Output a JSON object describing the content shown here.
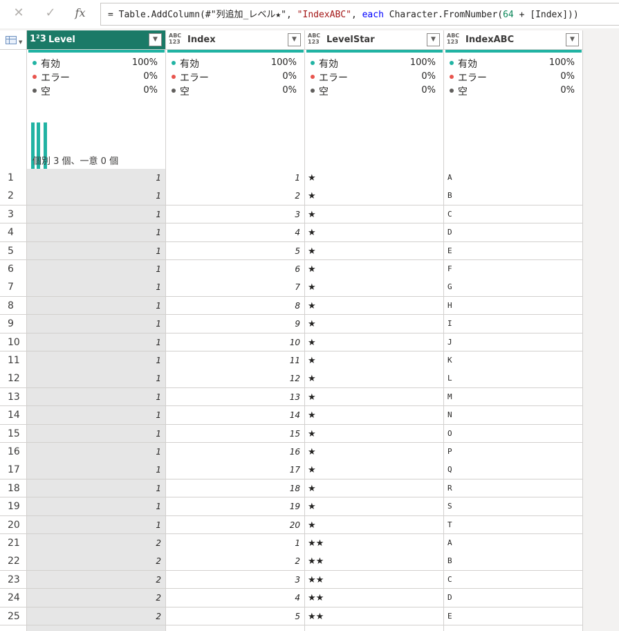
{
  "formula_bar": {
    "cancel_icon": "close-icon",
    "confirm_icon": "checkmark-icon",
    "fx_label": "fx",
    "formula_parts": {
      "p1": "= Table.AddColumn(#\"列追加_レベル★\", ",
      "p2": "\"IndexABC\"",
      "p3": ", ",
      "p4": "each",
      "p5": " Character.FromNumber(",
      "p6": "64",
      "p7": " + [Index]))"
    }
  },
  "columns": [
    {
      "type_label": "1²3",
      "title": "Level",
      "selected": true
    },
    {
      "type_label": "ABC 123",
      "title": "Index",
      "selected": false
    },
    {
      "type_label": "ABC 123",
      "title": "LevelStar",
      "selected": false
    },
    {
      "type_label": "ABC 123",
      "title": "IndexABC",
      "selected": false
    }
  ],
  "profile": {
    "valid_label": "有効",
    "error_label": "エラー",
    "empty_label": "空",
    "valid_pct": "100%",
    "error_pct": "0%",
    "empty_pct": "0%",
    "distribution_label": "個別 3 個、一意 0 個",
    "colors": {
      "valid": "#21b3a3",
      "error": "#e8554e",
      "empty": "#605e5c",
      "accent": "#1b7a67"
    }
  },
  "rows": [
    {
      "n": "1",
      "level": "1",
      "index": "1",
      "star": "★",
      "abc": "A"
    },
    {
      "n": "2",
      "level": "1",
      "index": "2",
      "star": "★",
      "abc": "B"
    },
    {
      "n": "3",
      "level": "1",
      "index": "3",
      "star": "★",
      "abc": "C"
    },
    {
      "n": "4",
      "level": "1",
      "index": "4",
      "star": "★",
      "abc": "D"
    },
    {
      "n": "5",
      "level": "1",
      "index": "5",
      "star": "★",
      "abc": "E"
    },
    {
      "n": "6",
      "level": "1",
      "index": "6",
      "star": "★",
      "abc": "F"
    },
    {
      "n": "7",
      "level": "1",
      "index": "7",
      "star": "★",
      "abc": "G"
    },
    {
      "n": "8",
      "level": "1",
      "index": "8",
      "star": "★",
      "abc": "H"
    },
    {
      "n": "9",
      "level": "1",
      "index": "9",
      "star": "★",
      "abc": "I"
    },
    {
      "n": "10",
      "level": "1",
      "index": "10",
      "star": "★",
      "abc": "J"
    },
    {
      "n": "11",
      "level": "1",
      "index": "11",
      "star": "★",
      "abc": "K"
    },
    {
      "n": "12",
      "level": "1",
      "index": "12",
      "star": "★",
      "abc": "L"
    },
    {
      "n": "13",
      "level": "1",
      "index": "13",
      "star": "★",
      "abc": "M"
    },
    {
      "n": "14",
      "level": "1",
      "index": "14",
      "star": "★",
      "abc": "N"
    },
    {
      "n": "15",
      "level": "1",
      "index": "15",
      "star": "★",
      "abc": "O"
    },
    {
      "n": "16",
      "level": "1",
      "index": "16",
      "star": "★",
      "abc": "P"
    },
    {
      "n": "17",
      "level": "1",
      "index": "17",
      "star": "★",
      "abc": "Q"
    },
    {
      "n": "18",
      "level": "1",
      "index": "18",
      "star": "★",
      "abc": "R"
    },
    {
      "n": "19",
      "level": "1",
      "index": "19",
      "star": "★",
      "abc": "S"
    },
    {
      "n": "20",
      "level": "1",
      "index": "20",
      "star": "★",
      "abc": "T"
    },
    {
      "n": "21",
      "level": "2",
      "index": "1",
      "star": "★★",
      "abc": "A"
    },
    {
      "n": "22",
      "level": "2",
      "index": "2",
      "star": "★★",
      "abc": "B"
    },
    {
      "n": "23",
      "level": "2",
      "index": "3",
      "star": "★★",
      "abc": "C"
    },
    {
      "n": "24",
      "level": "2",
      "index": "4",
      "star": "★★",
      "abc": "D"
    },
    {
      "n": "25",
      "level": "2",
      "index": "5",
      "star": "★★",
      "abc": "E"
    }
  ]
}
